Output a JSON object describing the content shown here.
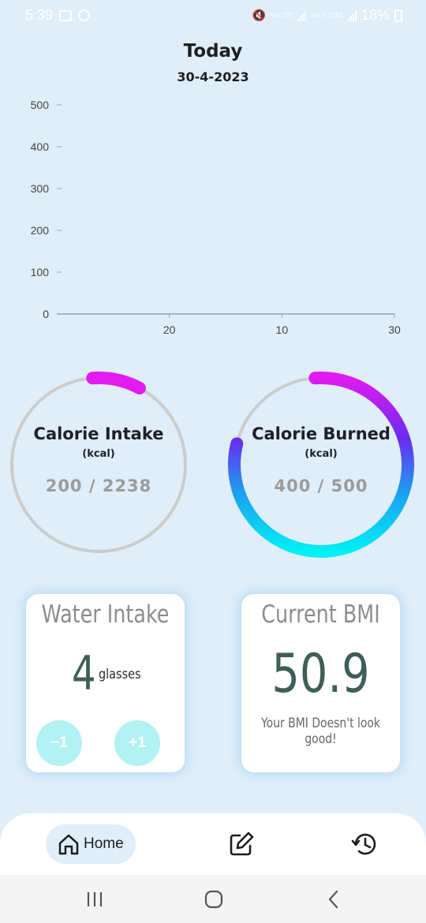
{
  "status_bar": {
    "time": "5:39",
    "battery": "18%",
    "net_labels": [
      "Vo) LTE",
      "Vo) R LTE2"
    ]
  },
  "header": {
    "title": "Today",
    "date": "30-4-2023"
  },
  "chart_data": {
    "type": "line",
    "title": "",
    "xlabel": "",
    "ylabel": "",
    "ylim": [
      0,
      500
    ],
    "yticks": [
      0,
      100,
      200,
      300,
      400,
      500
    ],
    "xticks": [
      "20",
      "10",
      "30"
    ],
    "series": []
  },
  "calorie_intake": {
    "title": "Calorie Intake",
    "unit": "(kcal)",
    "value_text": "200 / 2238",
    "consumed": 200,
    "goal": 2238,
    "color": "#e21bf0",
    "track_color": "#cccccc"
  },
  "calorie_burned": {
    "title": "Calorie Burned",
    "unit": "(kcal)",
    "value_text": "400 / 500",
    "burned": 400,
    "goal": 500,
    "gradient": [
      "#e21bf0",
      "#6a2af0",
      "#1e9cf0",
      "#00f0f5"
    ],
    "track_color": "#cccccc"
  },
  "water": {
    "title": "Water Intake",
    "count": "4",
    "unit": "glasses",
    "minus_label": "−1",
    "plus_label": "+1"
  },
  "bmi": {
    "title": "Current BMI",
    "value": "50.9",
    "message": "Your BMI Doesn't look good!"
  },
  "bottom_nav": {
    "home_label": "Home",
    "active": "home",
    "items": [
      "home-icon",
      "edit-icon",
      "history-icon"
    ]
  },
  "system_nav": {
    "items": [
      "recents-icon",
      "home-circle-icon",
      "back-icon"
    ]
  }
}
